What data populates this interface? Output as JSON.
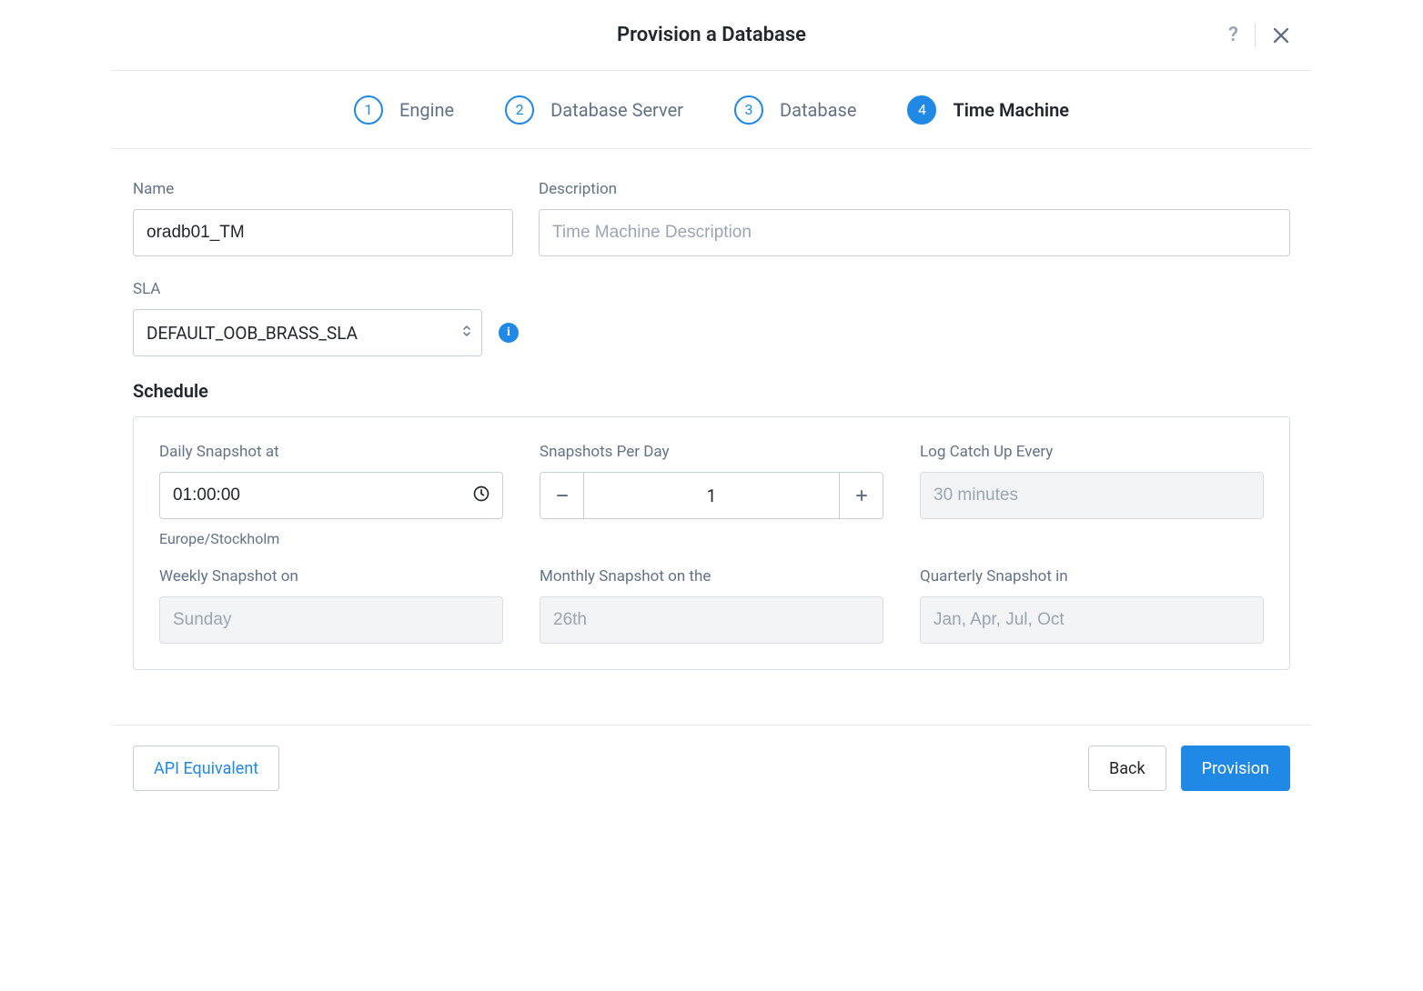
{
  "header": {
    "title": "Provision a Database"
  },
  "stepper": {
    "steps": [
      {
        "num": "1",
        "label": "Engine"
      },
      {
        "num": "2",
        "label": "Database Server"
      },
      {
        "num": "3",
        "label": "Database"
      },
      {
        "num": "4",
        "label": "Time Machine"
      }
    ],
    "active_index": 3
  },
  "fields": {
    "name_label": "Name",
    "name_value": "oradb01_TM",
    "description_label": "Description",
    "description_placeholder": "Time Machine Description",
    "sla_label": "SLA",
    "sla_value": "DEFAULT_OOB_BRASS_SLA"
  },
  "schedule": {
    "title": "Schedule",
    "daily_label": "Daily Snapshot at",
    "daily_value": "01:00:00",
    "timezone": "Europe/Stockholm",
    "per_day_label": "Snapshots Per Day",
    "per_day_value": "1",
    "log_catch_label": "Log Catch Up Every",
    "log_catch_value": "30 minutes",
    "weekly_label": "Weekly Snapshot on",
    "weekly_value": "Sunday",
    "monthly_label": "Monthly Snapshot on the",
    "monthly_value": "26th",
    "quarterly_label": "Quarterly Snapshot in",
    "quarterly_value": "Jan, Apr, Jul, Oct"
  },
  "footer": {
    "api_label": "API Equivalent",
    "back_label": "Back",
    "provision_label": "Provision"
  },
  "icons": {
    "help": "?",
    "info": "i"
  }
}
